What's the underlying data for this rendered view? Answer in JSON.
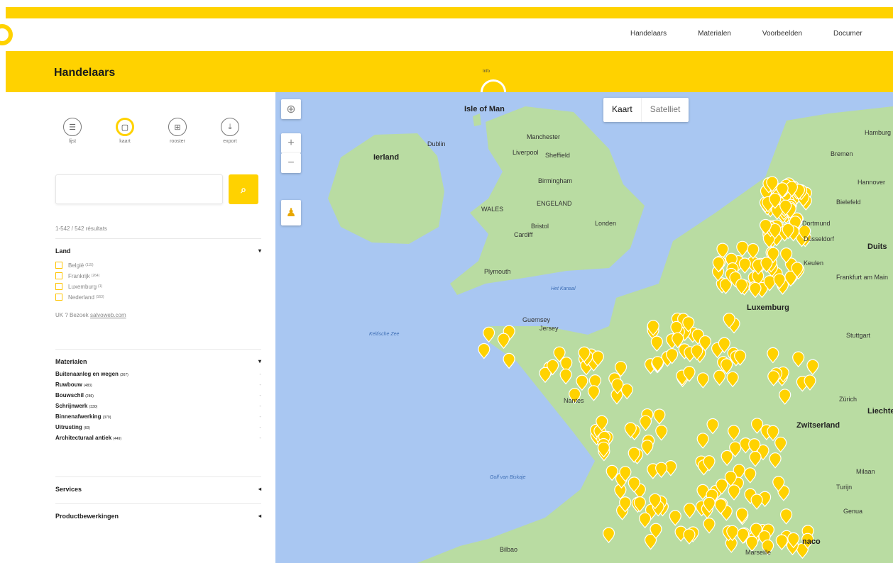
{
  "nav": {
    "items": [
      "Handelaars",
      "Materialen",
      "Voorbeelden",
      "Documer"
    ]
  },
  "header": {
    "title": "Handelaars",
    "info_label": "Info"
  },
  "views": [
    {
      "label": "lijst",
      "icon": "list-icon"
    },
    {
      "label": "kaart",
      "icon": "map-icon"
    },
    {
      "label": "rooster",
      "icon": "grid-icon"
    },
    {
      "label": "export",
      "icon": "download-icon"
    }
  ],
  "search": {
    "placeholder": "",
    "value": ""
  },
  "results": "1-542 / 542 résultats",
  "filters": {
    "land": {
      "title": "Land",
      "options": [
        {
          "label": "België",
          "count": "(115)"
        },
        {
          "label": "Frankrijk",
          "count": "(264)"
        },
        {
          "label": "Luxemburg",
          "count": "(1)"
        },
        {
          "label": "Nederland",
          "count": "(163)"
        }
      ],
      "uk_note": "UK ? Bezoek",
      "uk_link": "salvoweb.com"
    },
    "materialen": {
      "title": "Materialen",
      "items": [
        {
          "label": "Buitenaanleg en wegen",
          "count": "(367)"
        },
        {
          "label": "Ruwbouw",
          "count": "(483)"
        },
        {
          "label": "Bouwschil",
          "count": "(286)"
        },
        {
          "label": "Schrijnwerk",
          "count": "(330)"
        },
        {
          "label": "Binnenafwerking",
          "count": "(379)"
        },
        {
          "label": "Uitrusting",
          "count": "(60)"
        },
        {
          "label": "Architecturaal antiek",
          "count": "(449)"
        }
      ]
    },
    "services": {
      "title": "Services"
    },
    "productbewerkingen": {
      "title": "Productbewerkingen"
    }
  },
  "map": {
    "type_options": [
      "Kaart",
      "Satelliet"
    ],
    "labels": {
      "isle_of_man": "Isle of Man",
      "ierland": "Ierland",
      "dublin": "Dublin",
      "manchester": "Manchester",
      "liverpool": "Liverpool",
      "sheffield": "Sheffield",
      "birmingham": "Birmingham",
      "wales": "WALES",
      "england": "ENGELAND",
      "londen": "Londen",
      "cardiff": "Cardiff",
      "bristol": "Bristol",
      "plymouth": "Plymouth",
      "kanaal": "Het Kanaal",
      "keltische_zee": "Keltische Zee",
      "guernsey": "Guernsey",
      "jersey": "Jersey",
      "luxemburg": "Luxemburg",
      "hamburg": "Hamburg",
      "bremen": "Bremen",
      "hannover": "Hannover",
      "bielefeld": "Bielefeld",
      "dortmund": "Dortmund",
      "dusseldorf": "Düsseldorf",
      "duits": "Duits",
      "keulen": "Keulen",
      "frankfurt": "Frankfurt am Main",
      "stuttgart": "Stuttgart",
      "zurich": "Zürich",
      "zwitserland": "Zwitserland",
      "liechten": "Liechter",
      "milaan": "Milaan",
      "turijn": "Turijn",
      "genua": "Genua",
      "nantes": "Nantes",
      "golf": "Golf van Biskaje",
      "bilbao": "Bilbao",
      "monaco": "naco",
      "marseille": "Marseille"
    },
    "colors": {
      "water": "#a9c7f2",
      "land": "#b9dca2",
      "pin": "#ffd200"
    }
  }
}
